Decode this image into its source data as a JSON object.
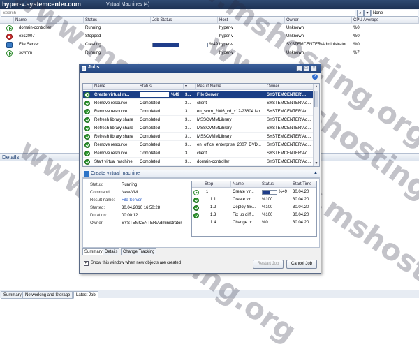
{
  "window": {
    "host": "hyper-v.systemcenter.com",
    "subtitle": "Virtual Machines (4)"
  },
  "search": {
    "placeholder": "Search",
    "filter": "None"
  },
  "vm_columns": [
    "Name",
    "Status",
    "Job Status",
    "Host",
    "Owner",
    "CPU Average"
  ],
  "vms": [
    {
      "name": "domain-controller",
      "status": "Running",
      "job": "",
      "host": "hyper-v",
      "owner": "Unknown",
      "cpu": "%0",
      "icon": "running-icon"
    },
    {
      "name": "exc2007",
      "status": "Stopped",
      "job": "",
      "host": "hyper-v",
      "owner": "Unknown",
      "cpu": "%0",
      "icon": "stopped-icon"
    },
    {
      "name": "File Server",
      "status": "Creating...",
      "job": "%49",
      "job_progress": 0.49,
      "host": "hyper-v",
      "owner": "SYSTEMCENTER\\Administrator",
      "cpu": "%0",
      "icon": "creating-icon"
    },
    {
      "name": "scvmm",
      "status": "Running",
      "job": "",
      "host": "hyper-v",
      "owner": "Unknown",
      "cpu": "%7",
      "icon": "running-icon"
    }
  ],
  "details_label": "Details",
  "bottom_tabs": [
    "Summary",
    "Networking and Storage",
    "Latest Job"
  ],
  "jobs": {
    "title": "Jobs",
    "columns": [
      "Name",
      "Status",
      "",
      "Result Name",
      "Owner"
    ],
    "rows": [
      {
        "name": "Create virtual m...",
        "status": "%49",
        "progress": 0.49,
        "col3": "3...",
        "result": "File Server",
        "owner": "SYSTEMCENTER\\...",
        "selected": true
      },
      {
        "name": "Remove resource",
        "status": "Completed",
        "col3": "3...",
        "result": "client",
        "owner": "SYSTEMCENTER\\Ad..."
      },
      {
        "name": "Remove resource",
        "status": "Completed",
        "col3": "3...",
        "result": "en_scrm_2006_cd_x12-23604.iso",
        "owner": "SYSTEMCENTER\\Ad..."
      },
      {
        "name": "Refresh library share",
        "status": "Completed",
        "col3": "3...",
        "result": "MSSCVMMLibrary",
        "owner": "SYSTEMCENTER\\Ad..."
      },
      {
        "name": "Refresh library share",
        "status": "Completed",
        "col3": "3...",
        "result": "MSSCVMMLibrary",
        "owner": "SYSTEMCENTER\\Ad..."
      },
      {
        "name": "Refresh library share",
        "status": "Completed",
        "col3": "3...",
        "result": "MSSCVMMLibrary",
        "owner": "SYSTEMCENTER\\Ad..."
      },
      {
        "name": "Remove resource",
        "status": "Completed",
        "col3": "3...",
        "result": "en_office_enterprise_2007_DVD...",
        "owner": "SYSTEMCENTER\\Ad..."
      },
      {
        "name": "Remove resource",
        "status": "Completed",
        "col3": "3...",
        "result": "client",
        "owner": "SYSTEMCENTER\\Ad..."
      },
      {
        "name": "Start virtual machine",
        "status": "Completed",
        "col3": "3...",
        "result": "domain-controller",
        "owner": "SYSTEMCENTER\\Ad..."
      }
    ],
    "detail_title": "Create virtual machine",
    "detail": {
      "status_k": "Status:",
      "status_v": "Running",
      "command_k": "Command:",
      "command_v": "New-VM",
      "result_k": "Result name:",
      "result_v": "File Server",
      "started_k": "Started:",
      "started_v": "30.04.2010 16:50:28",
      "duration_k": "Duration:",
      "duration_v": "00:00:12",
      "owner_k": "Owner:",
      "owner_v": "SYSTEMCENTER\\Administrator"
    },
    "step_columns": [
      "Step",
      "Name",
      "Status",
      "Start Time"
    ],
    "steps": [
      {
        "step": "1",
        "name": "Create vir...",
        "status": "%49",
        "progress": 0.49,
        "start": "30.04.20",
        "icon": "running"
      },
      {
        "step": "1.1",
        "name": "Create vir...",
        "status": "%100",
        "start": "30.04.20",
        "icon": "ok"
      },
      {
        "step": "1.2",
        "name": "Deploy file...",
        "status": "%100",
        "start": "30.04.20",
        "icon": "ok"
      },
      {
        "step": "1.3",
        "name": "Fix up diff...",
        "status": "%100",
        "start": "30.04.20",
        "icon": "ok"
      },
      {
        "step": "1.4",
        "name": "Change pr...",
        "status": "%0",
        "start": "30.04.20",
        "icon": "none"
      }
    ],
    "detail_tabs": [
      "Summary",
      "Details",
      "Change Tracking"
    ],
    "show_checkbox": "Show this window when new objects are created",
    "restart_btn": "Restart Job",
    "cancel_btn": "Cancel Job"
  },
  "watermark": "www.mshosting.org"
}
